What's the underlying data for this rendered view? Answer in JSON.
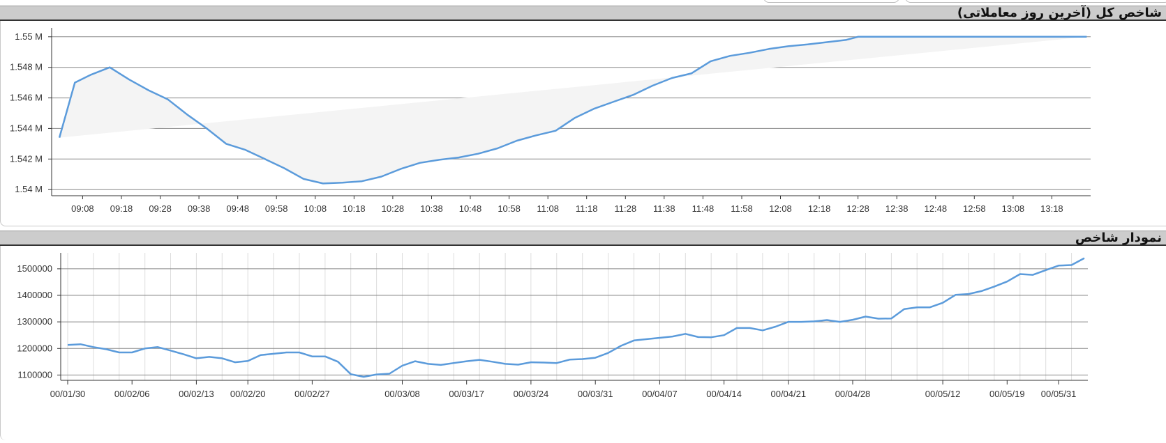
{
  "panels": {
    "intraday": {
      "title": "شاخص کل (آخرین روز معاملاتی)"
    },
    "history": {
      "title": "نمودار شاخص"
    }
  },
  "colors": {
    "line": "#5b9bdb",
    "area_fill": "#f4f4f4",
    "grid": "#888888",
    "header_bg": "#cccccc"
  },
  "chart_data": [
    {
      "type": "area",
      "title": "",
      "xlabel": "",
      "ylabel": "",
      "grid": true,
      "ylim": [
        1539600,
        1550400
      ],
      "y_ticks": [
        1540000,
        1542000,
        1544000,
        1546000,
        1548000,
        1550000
      ],
      "y_tick_labels": [
        "1.54 M",
        "1.542 M",
        "1.544 M",
        "1.546 M",
        "1.548 M",
        "1.55 M"
      ],
      "x_range": [
        "09:00",
        "13:28"
      ],
      "x_ticks": [
        "09:08",
        "09:18",
        "09:28",
        "09:38",
        "09:48",
        "09:58",
        "10:08",
        "10:18",
        "10:28",
        "10:38",
        "10:48",
        "10:58",
        "11:08",
        "11:18",
        "11:28",
        "11:38",
        "11:48",
        "11:58",
        "12:08",
        "12:18",
        "12:28",
        "12:38",
        "12:48",
        "12:58",
        "13:08",
        "13:18"
      ],
      "series": [
        {
          "x": [
            "09:02",
            "09:06",
            "09:10",
            "09:15",
            "09:20",
            "09:25",
            "09:30",
            "09:35",
            "09:40",
            "09:45",
            "09:50",
            "09:55",
            "10:00",
            "10:05",
            "10:10",
            "10:15",
            "10:20",
            "10:25",
            "10:30",
            "10:35",
            "10:40",
            "10:45",
            "10:50",
            "10:55",
            "11:00",
            "11:05",
            "11:10",
            "11:15",
            "11:20",
            "11:25",
            "11:30",
            "11:35",
            "11:40",
            "11:45",
            "11:50",
            "11:55",
            "12:00",
            "12:05",
            "12:10",
            "12:15",
            "12:20",
            "12:25",
            "12:28",
            "12:35",
            "12:45",
            "12:55",
            "13:05",
            "13:15",
            "13:20",
            "13:27"
          ],
          "y": [
            1543400,
            1547000,
            1547500,
            1548000,
            1547200,
            1546500,
            1545900,
            1544900,
            1544000,
            1543000,
            1542600,
            1542000,
            1541400,
            1540700,
            1540400,
            1540450,
            1540550,
            1540850,
            1541350,
            1541750,
            1541950,
            1542100,
            1542350,
            1542700,
            1543200,
            1543550,
            1543850,
            1544700,
            1545300,
            1545750,
            1546200,
            1546800,
            1547300,
            1547600,
            1548400,
            1548750,
            1548950,
            1549200,
            1549380,
            1549500,
            1549650,
            1549800,
            1550000,
            1550000,
            1550000,
            1550000,
            1550000,
            1550000,
            1550000,
            1550000
          ]
        }
      ]
    },
    {
      "type": "line",
      "title": "",
      "xlabel": "",
      "ylabel": "",
      "grid": true,
      "ylim": [
        1080000,
        1560000
      ],
      "y_ticks": [
        1100000,
        1200000,
        1300000,
        1400000,
        1500000
      ],
      "x_tick_labels": [
        {
          "label": "00/01/30",
          "pos": 0
        },
        {
          "label": "00/02/06",
          "pos": 5
        },
        {
          "label": "00/02/13",
          "pos": 10
        },
        {
          "label": "00/02/20",
          "pos": 14
        },
        {
          "label": "00/02/27",
          "pos": 19
        },
        {
          "label": "00/03/08",
          "pos": 26
        },
        {
          "label": "00/03/17",
          "pos": 31
        },
        {
          "label": "00/03/24",
          "pos": 36
        },
        {
          "label": "00/03/31",
          "pos": 41
        },
        {
          "label": "00/04/07",
          "pos": 46
        },
        {
          "label": "00/04/14",
          "pos": 51
        },
        {
          "label": "00/04/21",
          "pos": 56
        },
        {
          "label": "00/04/28",
          "pos": 61
        },
        {
          "label": "00/05/12",
          "pos": 68
        },
        {
          "label": "00/05/19",
          "pos": 73
        },
        {
          "label": "00/05/31",
          "pos": 77
        }
      ],
      "series": [
        {
          "values": [
            1213000,
            1216000,
            1205000,
            1197000,
            1185000,
            1185000,
            1200000,
            1205000,
            1192000,
            1178000,
            1163000,
            1168000,
            1163000,
            1148000,
            1153000,
            1175000,
            1180000,
            1185000,
            1185000,
            1170000,
            1170000,
            1150000,
            1103000,
            1093000,
            1102000,
            1105000,
            1135000,
            1152000,
            1142000,
            1138000,
            1145000,
            1152000,
            1157000,
            1150000,
            1142000,
            1139000,
            1148000,
            1147000,
            1145000,
            1158000,
            1160000,
            1165000,
            1183000,
            1210000,
            1230000,
            1235000,
            1240000,
            1245000,
            1255000,
            1243000,
            1242000,
            1250000,
            1277000,
            1277000,
            1268000,
            1282000,
            1300000,
            1300000,
            1302000,
            1307000,
            1300000,
            1308000,
            1320000,
            1312000,
            1313000,
            1348000,
            1355000,
            1355000,
            1372000,
            1402000,
            1405000,
            1416000,
            1433000,
            1452000,
            1480000,
            1477000,
            1495000,
            1512000,
            1514000,
            1540000
          ]
        }
      ]
    }
  ]
}
